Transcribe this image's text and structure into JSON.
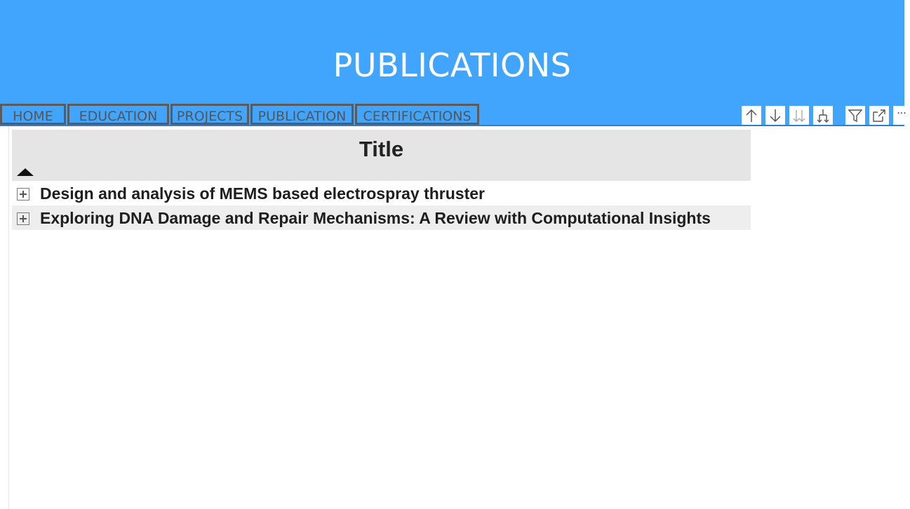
{
  "header": {
    "title": "PUBLICATIONS",
    "background": "#41a5fe"
  },
  "nav": [
    {
      "label": "HOME"
    },
    {
      "label": "EDUCATION"
    },
    {
      "label": "PROJECTS"
    },
    {
      "label": "PUBLICATION"
    },
    {
      "label": "CERTIFICATIONS"
    }
  ],
  "toolbar": [
    {
      "icon": "arrow-up-icon"
    },
    {
      "icon": "arrow-down-icon"
    },
    {
      "icon": "double-arrow-down-icon"
    },
    {
      "icon": "expand-hierarchy-icon"
    },
    {
      "icon": "filter-icon"
    },
    {
      "icon": "focus-mode-icon"
    },
    {
      "icon": "more-options-icon",
      "label": "···"
    }
  ],
  "table": {
    "column_header": "Title",
    "sort": "ascending",
    "rows": [
      {
        "title": "Design and analysis of MEMS based electrospray thruster"
      },
      {
        "title": "Exploring DNA Damage and Repair Mechanisms: A Review with Computational Insights"
      }
    ]
  }
}
